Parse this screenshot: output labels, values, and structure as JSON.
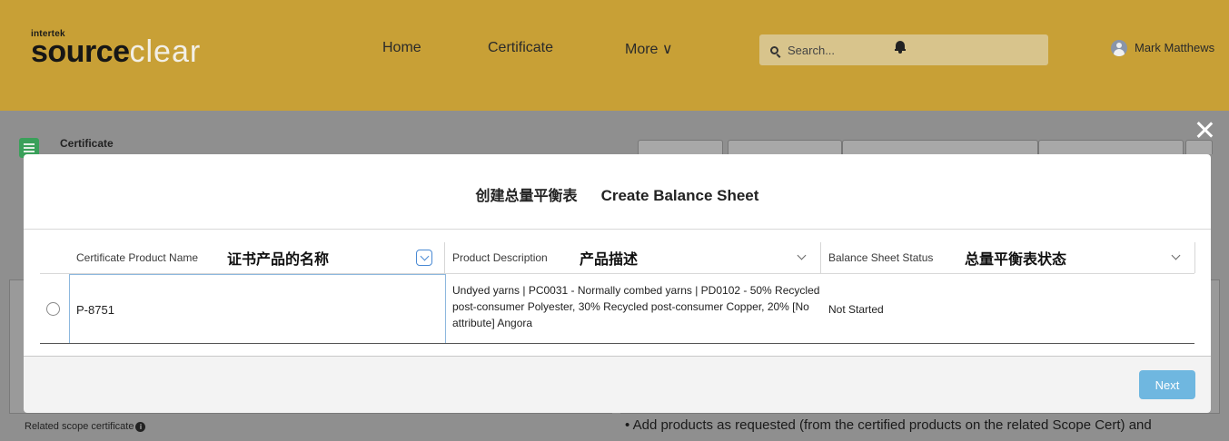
{
  "header": {
    "logo_small": "intertek",
    "logo_part1": "source",
    "logo_part2": "clear",
    "nav": [
      "Home",
      "Certificate",
      "More ∨"
    ],
    "search_placeholder": "Search...",
    "user_name": "Mark Matthews"
  },
  "page": {
    "object_title": "Certificate",
    "related_label": "Related scope certificate",
    "bullet_text": "• Add products as requested (from the certified products on the related Scope Cert) and"
  },
  "modal": {
    "title_zh": "创建总量平衡表",
    "title": "Create Balance Sheet",
    "columns": [
      {
        "label": "Certificate Product Name",
        "zh": "证书产品的名称"
      },
      {
        "label": "Product Description",
        "zh": "产品描述"
      },
      {
        "label": "Balance Sheet Status",
        "zh": "总量平衡表状态"
      }
    ],
    "rows": [
      {
        "name": "P-8751",
        "description": "Undyed yarns | PC0031 - Normally combed yarns | PD0102 - 50% Recycled post-consumer Polyester, 30% Recycled post-consumer Copper, 20% [No attribute] Angora",
        "status": "Not Started"
      }
    ],
    "next_label": "Next"
  }
}
